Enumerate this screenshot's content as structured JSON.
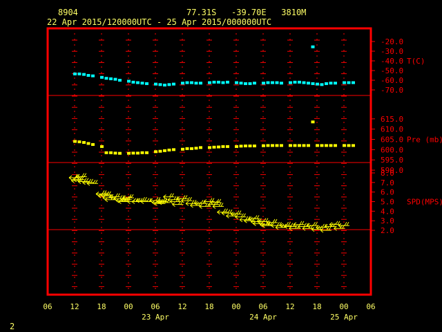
{
  "header": {
    "station_id": "8904",
    "location": "77.31S   -39.70E   3810M",
    "time_range": "22 Apr 2015/120000UTC - 25 Apr 2015/000000UTC"
  },
  "footer": {
    "page_number": "2"
  },
  "colors": {
    "frame": "#ff0000",
    "grid": "#ff0000",
    "axis_text": "#ff0000",
    "header_text": "#ffff66",
    "temperature": "#00ffff",
    "pressure": "#ffff00",
    "wind": "#ffff00"
  },
  "chart_data": {
    "type": "scatter",
    "x_axis": {
      "unit": "hours since 22 Apr 06 UTC",
      "range": [
        0,
        72
      ],
      "tick_labels": [
        "06",
        "12",
        "18",
        "00",
        "06",
        "12",
        "18",
        "00",
        "06",
        "12",
        "18",
        "00",
        "06"
      ],
      "date_labels": [
        "23 Apr",
        "24 Apr",
        "25 Apr"
      ]
    },
    "panels": [
      {
        "name": "temperature",
        "label": "T(C)",
        "range": [
          -70,
          -20
        ],
        "tick_labels": [
          "-20.0",
          "-30.0",
          "-40.0",
          "-50.0",
          "-60.0",
          "-70.0"
        ],
        "series": [
          {
            "x": [
              6,
              7,
              8,
              9,
              10,
              12,
              13,
              14,
              15,
              16,
              18,
              19,
              20,
              21,
              22,
              24,
              25,
              26,
              27,
              28,
              30,
              31,
              32,
              33,
              34,
              36,
              37,
              38,
              39,
              40,
              42,
              43,
              44,
              45,
              46,
              48,
              49,
              50,
              51,
              52,
              54,
              55,
              56,
              57,
              58,
              59,
              60,
              61,
              62,
              63,
              64,
              66,
              67,
              68
            ],
            "y": [
              -53.5,
              -53.5,
              -54,
              -55,
              -55.5,
              -57,
              -58,
              -58.5,
              -59,
              -60,
              -61,
              -62,
              -62.5,
              -63,
              -63.5,
              -64,
              -64.5,
              -65,
              -64.5,
              -64,
              -63,
              -62.5,
              -62.5,
              -63,
              -63,
              -62.5,
              -62,
              -62,
              -62.5,
              -62,
              -62.5,
              -63,
              -63.5,
              -63.5,
              -63,
              -63,
              -62.5,
              -62.5,
              -62.5,
              -63,
              -62.5,
              -62,
              -62,
              -62.5,
              -63,
              -63.5,
              -64,
              -64.5,
              -63.5,
              -63,
              -63,
              -62.5,
              -62.5,
              -62.5
            ]
          },
          {
            "x": [
              59
            ],
            "y": [
              -25.5
            ]
          }
        ]
      },
      {
        "name": "pressure",
        "label": "Pre (mb)",
        "range": [
          590,
          620
        ],
        "tick_labels": [
          "615.0",
          "610.0",
          "605.0",
          "600.0",
          "595.0",
          "590.0"
        ],
        "series": [
          {
            "x": [
              6,
              7,
              8,
              9,
              10,
              12,
              13,
              14,
              15,
              16,
              18,
              19,
              20,
              21,
              22,
              24,
              25,
              26,
              27,
              28,
              30,
              31,
              32,
              33,
              34,
              36,
              37,
              38,
              39,
              40,
              42,
              43,
              44,
              45,
              46,
              48,
              49,
              50,
              51,
              52,
              54,
              55,
              56,
              57,
              58,
              60,
              61,
              62,
              63,
              64,
              66,
              67,
              68
            ],
            "y": [
              604,
              603.8,
              603.5,
              603,
              602.5,
              601.5,
              598.5,
              598.5,
              598.3,
              598.2,
              598.2,
              598.3,
              598.3,
              598.5,
              598.5,
              599,
              599.2,
              599.5,
              599.8,
              600,
              600.2,
              600.5,
              600.5,
              600.7,
              601,
              601,
              601.2,
              601.3,
              601.5,
              601.5,
              601.5,
              601.7,
              601.8,
              601.8,
              601.8,
              601.9,
              602,
              602,
              602,
              602,
              602,
              602,
              602,
              602,
              602,
              602,
              602,
              602,
              602,
              602,
              602,
              602,
              602
            ]
          },
          {
            "x": [
              59
            ],
            "y": [
              613.5
            ]
          }
        ]
      },
      {
        "name": "wind_speed",
        "label": "SPD(MPS)",
        "range": [
          2,
          8
        ],
        "tick_labels": [
          "8.0",
          "7.0",
          "6.0",
          "5.0",
          "4.0",
          "3.0",
          "2.0"
        ],
        "series": [
          {
            "x": [
              6,
              6.5,
              7,
              7.5,
              8,
              9,
              10,
              12,
              12.5,
              13,
              13.5,
              14,
              15,
              16,
              16.5,
              17,
              17.5,
              18,
              19,
              20,
              21,
              22,
              24,
              24.5,
              25,
              25.5,
              26,
              27,
              28,
              28.5,
              29,
              30,
              31,
              32,
              33,
              34,
              35,
              36,
              37,
              37.5,
              38,
              39,
              40,
              41,
              42,
              43,
              44,
              45,
              46,
              46.5,
              47,
              48,
              48.5,
              49,
              50,
              51,
              52,
              53,
              54,
              55,
              56,
              57,
              58,
              59,
              60,
              61,
              62,
              63,
              64,
              65,
              66
            ],
            "y": [
              7.5,
              7.2,
              7.3,
              7.6,
              7.1,
              7.0,
              6.9,
              5.8,
              5.6,
              5.7,
              5.4,
              5.2,
              5.5,
              5.3,
              5.1,
              5.0,
              5.2,
              5.4,
              5.0,
              5.0,
              5.1,
              5.0,
              5.1,
              4.9,
              4.8,
              5.0,
              4.9,
              5.5,
              5.2,
              5.0,
              4.7,
              5.3,
              5.1,
              4.8,
              4.6,
              4.8,
              4.5,
              5.0,
              4.7,
              4.9,
              4.5,
              3.9,
              3.8,
              3.5,
              3.7,
              3.4,
              3.1,
              3.0,
              3.2,
              2.9,
              2.7,
              2.9,
              2.6,
              2.5,
              2.8,
              2.5,
              2.3,
              2.5,
              2.4,
              2.2,
              2.6,
              2.4,
              2.2,
              2.5,
              2.1,
              2.3,
              2.0,
              2.4,
              2.6,
              2.2,
              2.5
            ]
          }
        ]
      }
    ]
  }
}
